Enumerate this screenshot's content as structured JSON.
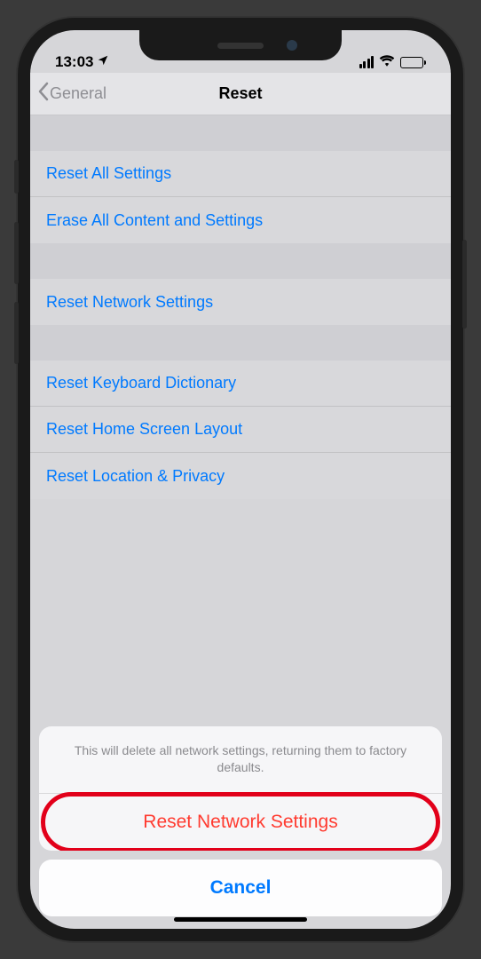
{
  "status": {
    "time": "13:03"
  },
  "nav": {
    "back": "General",
    "title": "Reset"
  },
  "groups": [
    {
      "items": [
        {
          "label": "Reset All Settings"
        },
        {
          "label": "Erase All Content and Settings"
        }
      ]
    },
    {
      "items": [
        {
          "label": "Reset Network Settings"
        }
      ]
    },
    {
      "items": [
        {
          "label": "Reset Keyboard Dictionary"
        },
        {
          "label": "Reset Home Screen Layout"
        },
        {
          "label": "Reset Location & Privacy"
        }
      ]
    }
  ],
  "sheet": {
    "message": "This will delete all network settings, returning them to factory defaults.",
    "action": "Reset Network Settings",
    "cancel": "Cancel"
  }
}
